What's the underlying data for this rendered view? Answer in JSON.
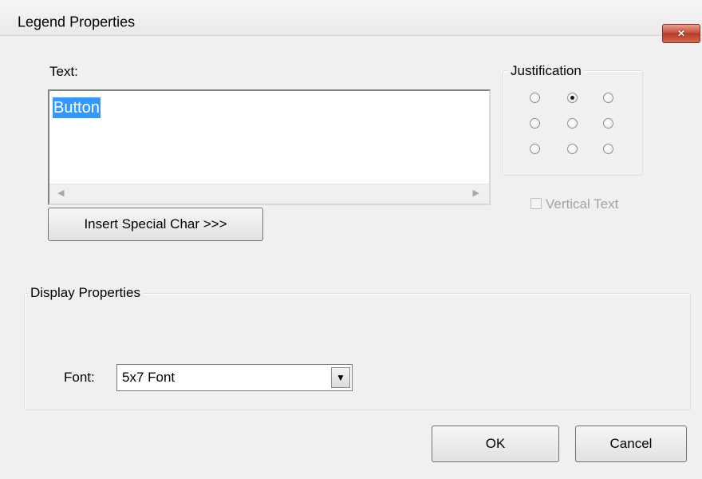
{
  "window": {
    "title": "Legend Properties",
    "close_icon": "×"
  },
  "text_section": {
    "label": "Text:",
    "value": "Button"
  },
  "insert_button": {
    "label": "Insert Special Char >>>"
  },
  "justification": {
    "label": "Justification",
    "selected_index": 1,
    "options_count": 9
  },
  "vertical_text": {
    "label": "Vertical Text",
    "checked": false,
    "enabled": false
  },
  "display_properties": {
    "label": "Display Properties",
    "font_label": "Font:",
    "font_value": "5x7 Font"
  },
  "buttons": {
    "ok": "OK",
    "cancel": "Cancel"
  },
  "icons": {
    "close": "close-icon",
    "scroll_left": "scroll-left-icon",
    "scroll_right": "scroll-right-icon",
    "dropdown": "chevron-down-icon"
  },
  "colors": {
    "selection": "#3399ff",
    "close_button": "#c9533f"
  }
}
